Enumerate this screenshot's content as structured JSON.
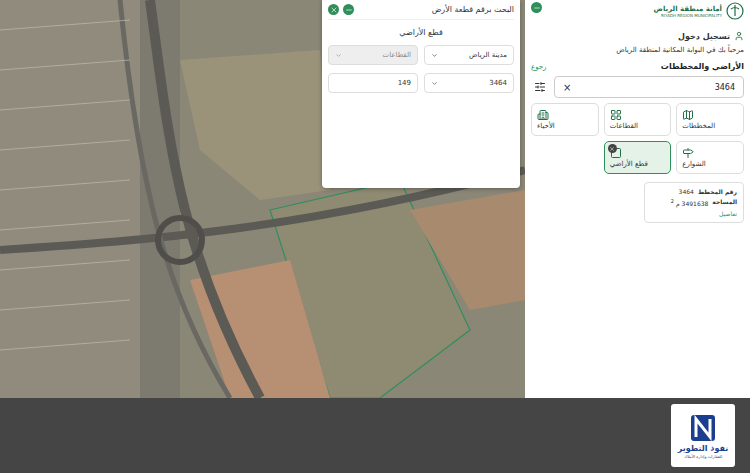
{
  "popup": {
    "title": "البحث برقم قطعة الأرض",
    "section": "قطع الأراضي",
    "fields": [
      {
        "value": "مدينة الرياض",
        "dropdown": true,
        "disabled": false
      },
      {
        "value": "القطاعات",
        "dropdown": true,
        "disabled": true
      },
      {
        "value": "3464",
        "dropdown": true,
        "disabled": false
      },
      {
        "value": "149",
        "dropdown": false,
        "disabled": false
      }
    ]
  },
  "header": {
    "org_name": "أمانة منطقة الرياض",
    "org_name_en": "RIYADH REGION MUNICIPALITY",
    "login": "تسجيل دخول",
    "welcome": "مرحباً بك في البوابة المكانية لمنطقة الرياض"
  },
  "panel": {
    "title": "الأراضي والمخططات",
    "back": "رجوع",
    "search_value": "3464",
    "clear": "×",
    "categories": [
      {
        "label": "المخططات",
        "selected": false
      },
      {
        "label": "القطاعات",
        "selected": false
      },
      {
        "label": "الأحياء",
        "selected": false
      },
      {
        "label": "الشوارع",
        "selected": false
      },
      {
        "label": "قطع الأراضي",
        "selected": true
      }
    ],
    "results": [
      {
        "plan_label": "رقم المخطط",
        "plan_number": "3464",
        "area_label": "المساحة",
        "area_value": "3491638",
        "area_unit": "م",
        "area_power": "2",
        "details": "تفاصيل"
      }
    ]
  },
  "footer": {
    "brand": "نفوذ التطوير",
    "tagline": "للعقارات وإدارة الأملاك"
  }
}
